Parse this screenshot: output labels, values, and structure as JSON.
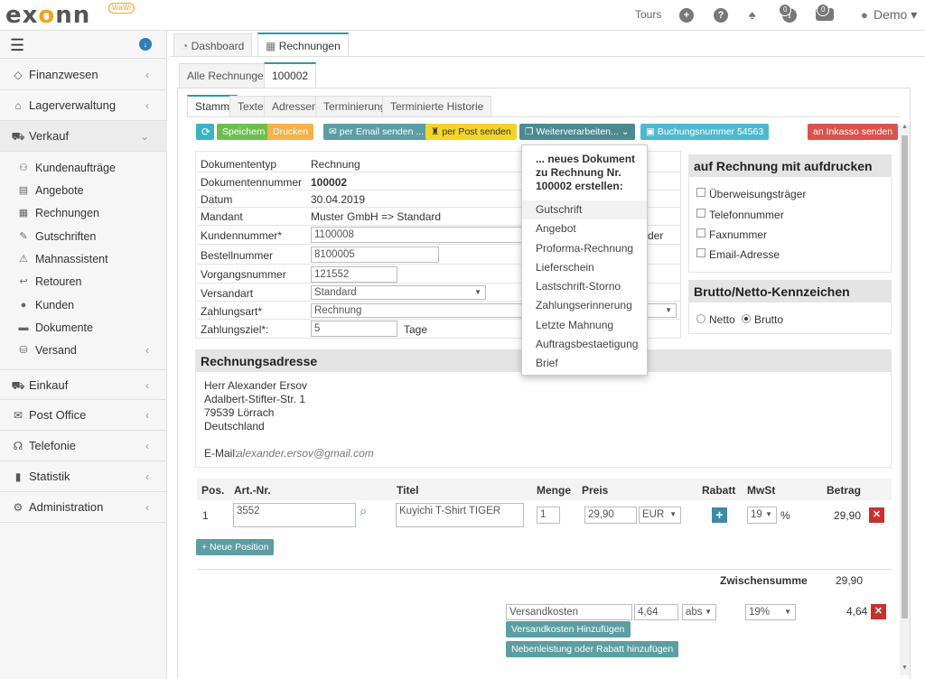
{
  "topbar": {
    "logo": "exonn",
    "logo_badge": "WaWi",
    "tours": "Tours",
    "badge1": "0",
    "badge2": "0",
    "user": "Demo"
  },
  "sidebar": {
    "items": [
      {
        "label": "Finanzwesen",
        "icon": "diamond-icon"
      },
      {
        "label": "Lagerverwaltung",
        "icon": "warehouse-icon"
      },
      {
        "label": "Verkauf",
        "icon": "cart-icon"
      },
      {
        "label": "Einkauf",
        "icon": "truck-icon"
      },
      {
        "label": "Post Office",
        "icon": "mail-icon"
      },
      {
        "label": "Telefonie",
        "icon": "headset-icon"
      },
      {
        "label": "Statistik",
        "icon": "bar-chart-icon"
      },
      {
        "label": "Administration",
        "icon": "gears-icon"
      }
    ],
    "sub": [
      {
        "label": "Kundenaufträge"
      },
      {
        "label": "Angebote"
      },
      {
        "label": "Rechnungen"
      },
      {
        "label": "Gutschriften"
      },
      {
        "label": "Mahnassistent"
      },
      {
        "label": "Retouren"
      },
      {
        "label": "Kunden"
      },
      {
        "label": "Dokumente"
      },
      {
        "label": "Versand"
      }
    ]
  },
  "tabs": {
    "main": [
      "Dashboard",
      "Rechnungen"
    ],
    "sub": [
      "Alle Rechnungen",
      "100002"
    ],
    "doc": [
      "Stamm",
      "Texte",
      "Adressen",
      "Terminierung",
      "Terminierte Historie"
    ]
  },
  "toolbar": {
    "refresh": "⟳",
    "save": "Speichern",
    "print": "Drucken",
    "email": "per Email senden ...",
    "post": "per Post senden",
    "further": "Weiterverarbeiten...",
    "booking": "Buchungsnummer 54563",
    "inkasso": "an Inkasso senden"
  },
  "form": {
    "doctype_label": "Dokumententyp",
    "doctype_value": "Rechnung",
    "docnum_label": "Dokumentennummer",
    "docnum_value": "100002",
    "date_label": "Datum",
    "date_value": "30.04.2019",
    "mandant_label": "Mandant",
    "mandant_value": "Muster GmbH => Standard",
    "customer_label": "Kundennummer*",
    "customer_value": "1100008",
    "customer_suffix": "der",
    "order_label": "Bestellnummer",
    "order_value": "8100005",
    "process_label": "Vorgangsnummer",
    "process_value": "121552",
    "shipping_label": "Versandart",
    "shipping_value": "Standard",
    "payment_label": "Zahlungsart*",
    "payment_value": "Rechnung",
    "term_label": "Zahlungsziel*:",
    "term_value": "5",
    "term_unit": "Tage"
  },
  "dropdown": {
    "header": "... neues Dokument zu Rechnung Nr. 100002 erstellen:",
    "items": [
      "Gutschrift",
      "Angebot",
      "Proforma-Rechnung",
      "Lieferschein",
      "Lastschrift-Storno",
      "Zahlungserinnerung",
      "Letzte Mahnung",
      "Auftragsbestaetigung",
      "Brief"
    ]
  },
  "print_panel": {
    "title": "auf Rechnung mit aufdrucken",
    "options": [
      "Überweisungsträger",
      "Telefonnummer",
      "Faxnummer",
      "Email-Adresse"
    ]
  },
  "tax_panel": {
    "title": "Brutto/Netto-Kennzeichen",
    "netto": "Netto",
    "brutto": "Brutto",
    "selected": "Brutto"
  },
  "address": {
    "title": "Rechnungsadresse",
    "lines": [
      "Herr Alexander Ersov",
      "Adalbert-Stifter-Str. 1",
      "79539 Lörrach",
      "Deutschland"
    ],
    "email_label": "E-Mail:",
    "email": "alexander.ersov@gmail.com"
  },
  "positions": {
    "headers": [
      "Pos.",
      "Art.-Nr.",
      "Titel",
      "Menge",
      "Preis",
      "Rabatt",
      "MwSt",
      "Betrag"
    ],
    "rows": [
      {
        "pos": "1",
        "art": "3552",
        "title": "Kuyichi T-Shirt TIGER",
        "qty": "1",
        "price": "29,90",
        "currency": "EUR",
        "vat": "19",
        "vat_unit": "%",
        "amount": "29,90"
      }
    ],
    "new_position": "+ Neue Position"
  },
  "totals": {
    "subtotal_label": "Zwischensumme",
    "subtotal": "29,90",
    "shipping_label": "Versandkosten",
    "shipping_value": "4,64",
    "shipping_type": "abs",
    "shipping_vat": "19%",
    "shipping_amount": "4,64",
    "add_shipping": "Versandkosten Hinzufügen",
    "add_extra": "Nebenleistung oder Rabatt hinzufügen"
  }
}
